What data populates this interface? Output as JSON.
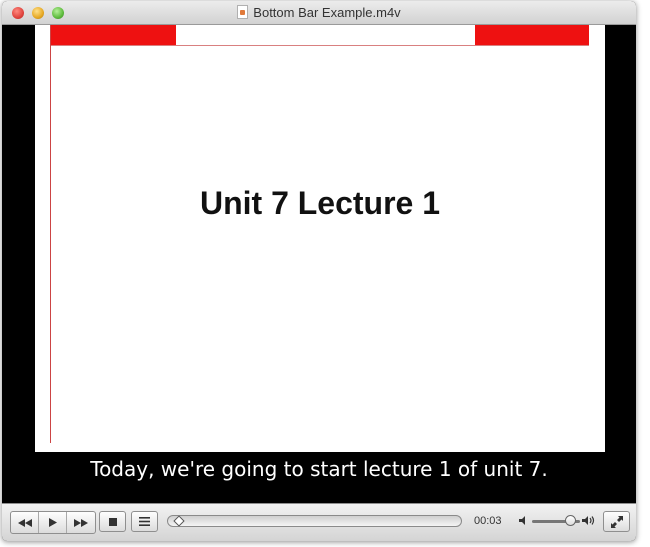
{
  "window": {
    "title": "Bottom Bar Example.m4v"
  },
  "slide": {
    "heading": "Unit 7 Lecture 1",
    "accent_color": "#ee1111"
  },
  "caption": {
    "text": "Today, we're going to start lecture 1 of unit 7."
  },
  "controls": {
    "icons": {
      "rewind": "rewind-icon",
      "play": "play-icon",
      "fast_forward": "fast-forward-icon",
      "stop": "stop-icon",
      "chapters": "chapter-list-icon",
      "volume_low": "volume-low-icon",
      "volume_high": "volume-high-icon",
      "fullscreen": "fullscreen-icon"
    },
    "current_time": "00:03",
    "progress_fraction": 0.01,
    "volume_fraction": 0.8
  }
}
